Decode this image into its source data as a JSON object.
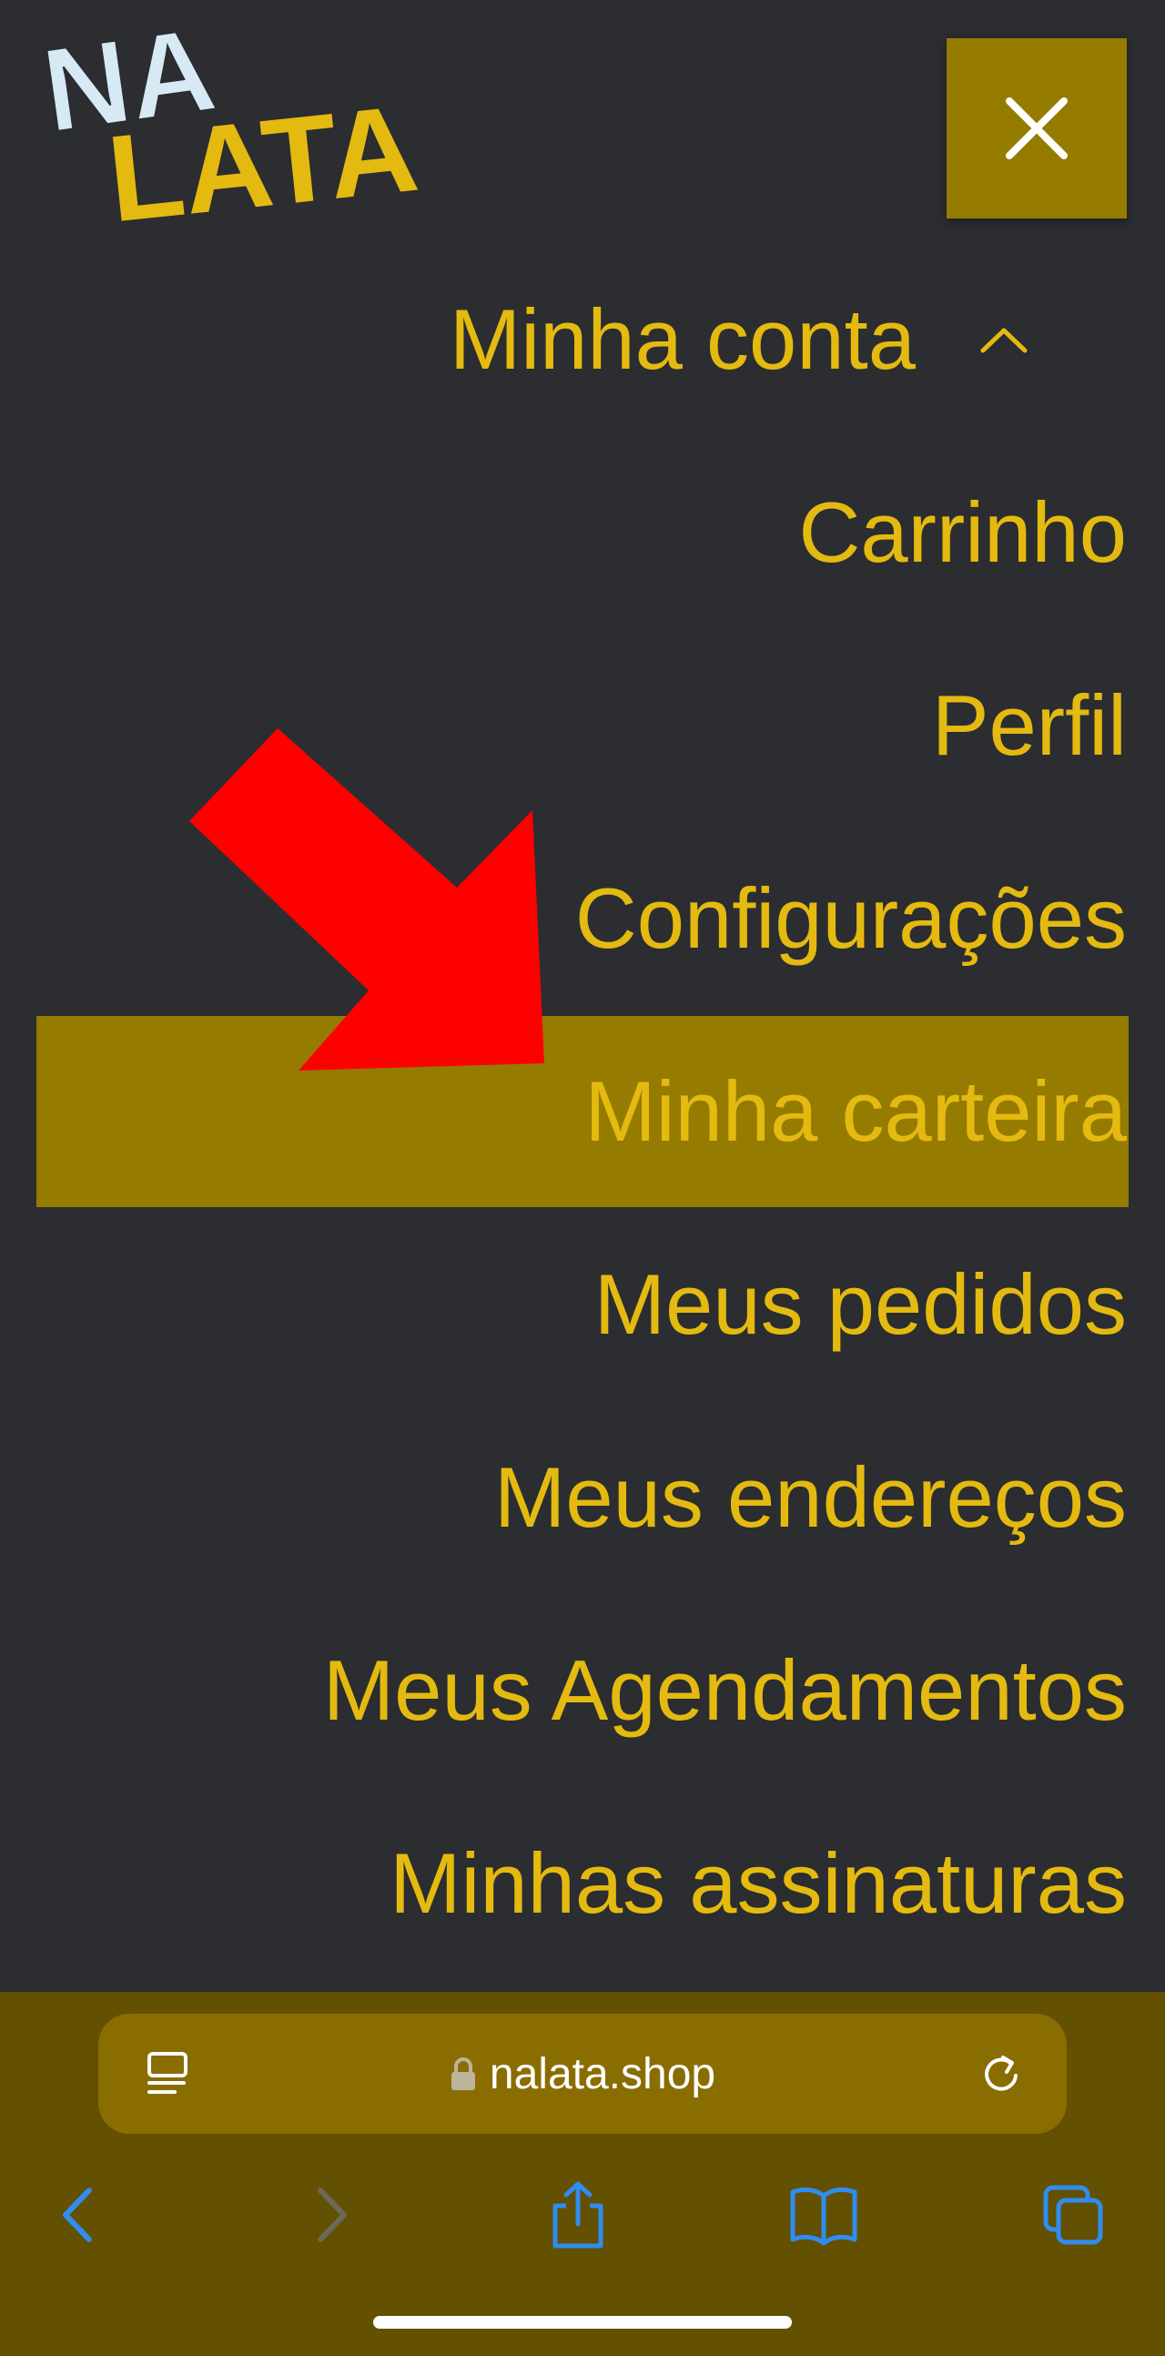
{
  "logo": {
    "line1": "NA",
    "line2": "LATA",
    "colors": {
      "line1": "#d6e9f5",
      "line2": "#e4ba10"
    }
  },
  "close_button": {
    "icon": "close-icon"
  },
  "menu": {
    "account": {
      "label": "Minha conta",
      "icon": "chevron-up-icon"
    },
    "items": [
      {
        "label": "Carrinho"
      },
      {
        "label": "Perfil"
      },
      {
        "label": "Configurações"
      },
      {
        "label": "Minha carteira",
        "active": true
      },
      {
        "label": "Meus pedidos"
      },
      {
        "label": "Meus endereços"
      },
      {
        "label": "Meus Agendamentos"
      },
      {
        "label": "Minhas assinaturas"
      }
    ]
  },
  "annotation": {
    "icon": "red-arrow-icon",
    "color": "#ff0000"
  },
  "browser": {
    "url": "nalata.shop",
    "icons": [
      "reader-icon",
      "lock-icon",
      "reload-icon",
      "back-icon",
      "forward-icon",
      "share-icon",
      "bookmarks-icon",
      "tabs-icon"
    ]
  },
  "colors": {
    "background": "#2b2d30",
    "accent": "#e4ba10",
    "active_bg": "#957b00",
    "browser_bg": "#635001",
    "link_blue": "#2f8df0"
  }
}
